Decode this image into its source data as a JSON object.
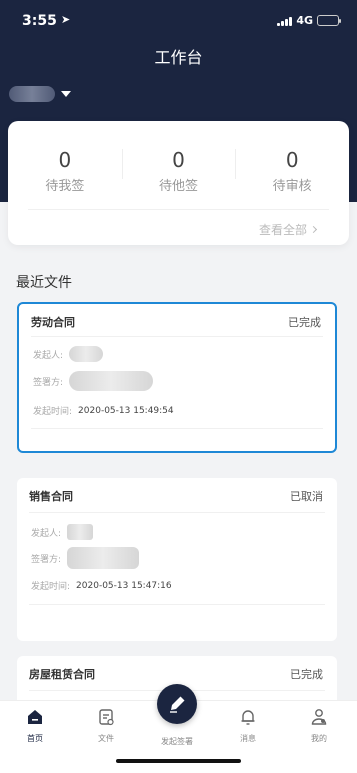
{
  "status_bar": {
    "time": "3:55",
    "network": "4G"
  },
  "header": {
    "title": "工作台"
  },
  "stats": [
    {
      "count": "0",
      "label": "待我签"
    },
    {
      "count": "0",
      "label": "待他签"
    },
    {
      "count": "0",
      "label": "待审核"
    }
  ],
  "view_all": "查看全部",
  "recent_title": "最近文件",
  "documents": [
    {
      "name": "劳动合同",
      "status": "已完成",
      "initiator_label": "发起人:",
      "signer_label": "签署方:",
      "time_label": "发起时间:",
      "time": "2020-05-13 15:49:54"
    },
    {
      "name": "销售合同",
      "status": "已取消",
      "initiator_label": "发起人:",
      "signer_label": "签署方:",
      "time_label": "发起时间:",
      "time": "2020-05-13 15:47:16"
    },
    {
      "name": "房屋租赁合同",
      "status": "已完成"
    }
  ],
  "tabs": {
    "home": "首页",
    "files": "文件",
    "initiate": "发起签署",
    "messages": "消息",
    "mine": "我的"
  },
  "colors": {
    "header_bg": "#1b2540",
    "selection_border": "#1e88d6",
    "battery": "#4cd964"
  }
}
